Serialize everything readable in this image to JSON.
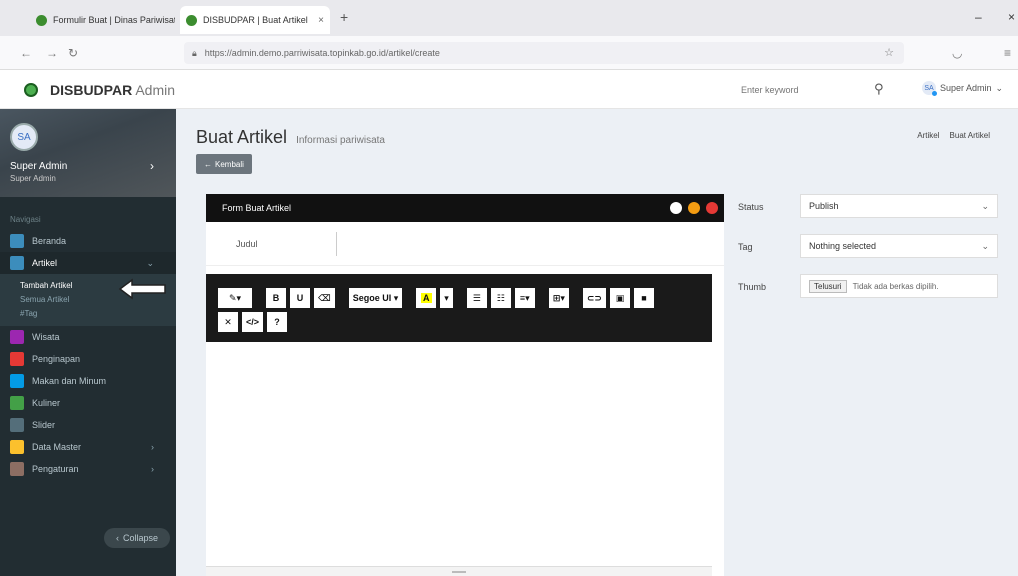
{
  "browser": {
    "tabs": [
      {
        "title": "Formulir Buat | Dinas Pariwisata",
        "active": false
      },
      {
        "title": "DISBUDPAR | Buat Artikel",
        "active": true
      }
    ],
    "url": "https://admin.demo.parriwisata.topinkab.go.id/artikel/create",
    "win_min": "–",
    "win_close": "×"
  },
  "header": {
    "brand_bold": "DISBUDPAR",
    "brand_light": "Admin",
    "search_placeholder": "Enter keyword",
    "user_initials": "SA",
    "user_name": "Super Admin"
  },
  "sidebar": {
    "user_initials": "SA",
    "user_name": "Super Admin",
    "user_role": "Super Admin",
    "nav_heading": "Navigasi",
    "items": [
      {
        "label": "Beranda",
        "color": "#3c8dbc"
      },
      {
        "label": "Artikel",
        "color": "#3c8dbc",
        "active": true
      },
      {
        "label": "Wisata",
        "color": "#9c27b0"
      },
      {
        "label": "Penginapan",
        "color": "#e53935"
      },
      {
        "label": "Makan dan Minum",
        "color": "#039be5"
      },
      {
        "label": "Kuliner",
        "color": "#43a047"
      },
      {
        "label": "Slider",
        "color": "#546e7a"
      },
      {
        "label": "Data Master",
        "color": "#fbc02d"
      },
      {
        "label": "Pengaturan",
        "color": "#8d6e63"
      }
    ],
    "sub_items": [
      "Tambah Artikel",
      "Semua Artikel",
      "#Tag"
    ],
    "collapse_label": "Collapse"
  },
  "page": {
    "title": "Buat Artikel",
    "subtitle": "Informasi pariwisata",
    "breadcrumb": [
      "Artikel",
      "Buat Artikel"
    ],
    "back_label": "Kembali"
  },
  "form": {
    "panel_title": "Form Buat Artikel",
    "judul_label": "Judul",
    "font_name": "Segoe UI"
  },
  "side_form": {
    "status_label": "Status",
    "status_value": "Publish",
    "tag_label": "Tag",
    "tag_value": "Nothing selected",
    "thumb_label": "Thumb",
    "file_button": "Telusuri",
    "file_text": "Tidak ada berkas dipilih."
  }
}
